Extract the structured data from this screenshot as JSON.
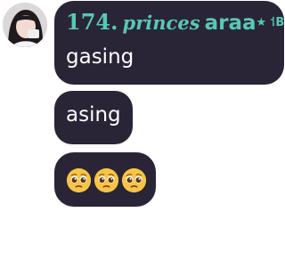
{
  "sender": {
    "number": "174.",
    "name_script": "princes",
    "name_plain": "araa",
    "decoration": "★ ⸶BP"
  },
  "messages": [
    {
      "text": "gasing"
    },
    {
      "text": "asing"
    }
  ],
  "emoji_message": {
    "emoji_name": "pleading-face-emoji",
    "count": 3
  },
  "colors": {
    "bubble": "#2a2437",
    "name_accent": "#57c8b4",
    "message_text": "#ffffff",
    "background": "#ffffff"
  }
}
